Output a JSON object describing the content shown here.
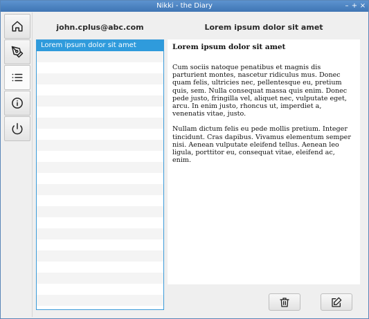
{
  "window": {
    "title": "Nikki - the Diary",
    "controls": {
      "minimize": "–",
      "maximize": "+",
      "close": "×"
    }
  },
  "sidebar": {
    "buttons": [
      {
        "name": "home",
        "icon": "home-icon"
      },
      {
        "name": "write",
        "icon": "pen-icon"
      },
      {
        "name": "list",
        "icon": "list-icon"
      },
      {
        "name": "info",
        "icon": "info-icon"
      },
      {
        "name": "power",
        "icon": "power-icon"
      }
    ],
    "active": "list"
  },
  "user": {
    "email": "john.cplus@abc.com"
  },
  "entries": {
    "items": [
      "Lorem ipsum dolor sit amet"
    ],
    "selected_index": 0
  },
  "entry": {
    "header": "Lorem ipsum dolor sit amet",
    "title": "Lorem ipsum dolor sit amet",
    "paragraphs": [
      "Cum sociis natoque penatibus et magnis dis parturient montes, nascetur ridiculus mus. Donec quam felis, ultricies nec, pellentesque eu, pretium quis, sem. Nulla consequat massa quis enim. Donec pede justo, fringilla vel, aliquet nec, vulputate eget, arcu. In enim justo, rhoncus ut, imperdiet a, venenatis vitae, justo.",
      "Nullam dictum felis eu pede mollis pretium. Integer tincidunt. Cras dapibus. Vivamus elementum semper nisi. Aenean vulputate eleifend tellus. Aenean leo ligula, porttitor eu, consequat vitae, eleifend ac, enim."
    ]
  },
  "actions": [
    {
      "name": "delete",
      "icon": "trash-icon"
    },
    {
      "name": "edit",
      "icon": "edit-icon"
    }
  ],
  "colors": {
    "titlebar": "#4a82c2",
    "selection": "#2f9bdc",
    "list_border": "#3a9bd9"
  }
}
